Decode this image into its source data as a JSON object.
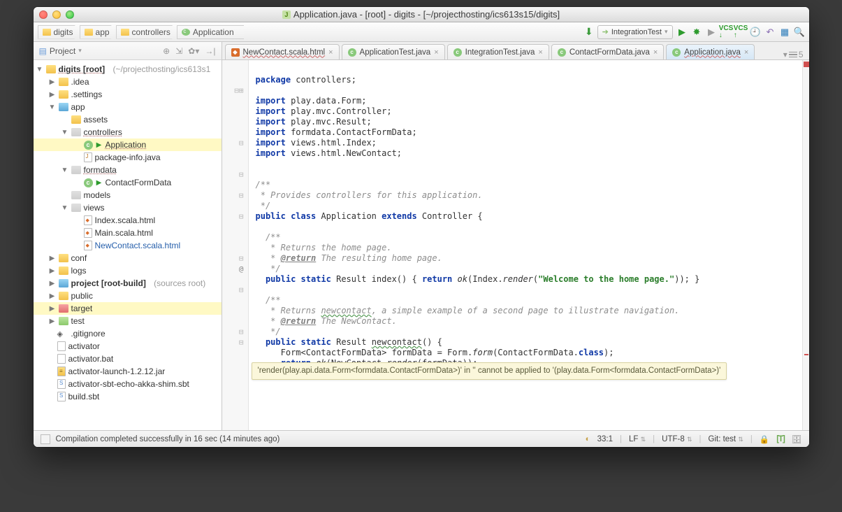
{
  "window": {
    "title": "Application.java - [root] - digits - [~/projecthosting/ics613s15/digits]"
  },
  "breadcrumbs": [
    "digits",
    "app",
    "controllers",
    "Application"
  ],
  "runconfig": "IntegrationTest",
  "sidebar": {
    "title": "Project",
    "root": "digits [root]",
    "root_hint": "(~/projecthosting/ics613s1",
    "nodes": {
      "idea": ".idea",
      "settings": ".settings",
      "app": "app",
      "assets": "assets",
      "controllers": "controllers",
      "application": "Application",
      "package_info": "package-info.java",
      "formdata": "formdata",
      "contactformdata": "ContactFormData",
      "models": "models",
      "views": "views",
      "index_html": "Index.scala.html",
      "main_html": "Main.scala.html",
      "newcontact_html": "NewContact.scala.html",
      "conf": "conf",
      "logs": "logs",
      "project": "project [root-build]",
      "project_hint": "(sources root)",
      "public": "public",
      "target": "target",
      "test": "test",
      "gitignore": ".gitignore",
      "activator": "activator",
      "activator_bat": "activator.bat",
      "activator_jar": "activator-launch-1.2.12.jar",
      "activator_sbt": "activator-sbt-echo-akka-shim.sbt",
      "build_sbt": "build.sbt"
    }
  },
  "tabs": [
    {
      "label": "NewContact.scala.html",
      "icon": "h",
      "wavy": true,
      "blue": false
    },
    {
      "label": "ApplicationTest.java",
      "icon": "c",
      "wavy": false,
      "blue": false
    },
    {
      "label": "IntegrationTest.java",
      "icon": "c",
      "wavy": false,
      "blue": false
    },
    {
      "label": "ContactFormData.java",
      "icon": "c",
      "wavy": false,
      "blue": false
    },
    {
      "label": "Application.java",
      "icon": "c",
      "wavy": true,
      "blue": true,
      "active": true
    }
  ],
  "code": {
    "l1_kw": "package",
    "l1_rest": " controllers;",
    "l2_kw": "import",
    "l2_rest": " play.data.Form;",
    "l3_kw": "import",
    "l3_rest": " play.mvc.Controller;",
    "l4_kw": "import",
    "l4_rest": " play.mvc.Result;",
    "l5_kw": "import",
    "l5_rest": " formdata.ContactFormData;",
    "l6_kw": "import",
    "l6_rest": " views.html.Index;",
    "l7_kw": "import",
    "l7_rest": " views.html.NewContact;",
    "doc1_a": "/**",
    "doc1_b": " * Provides controllers for this application.",
    "doc1_c": " */",
    "cls_a": "public class ",
    "cls_name": "Application ",
    "cls_b": "extends ",
    "cls_sup": "Controller {",
    "doc2_a": "/**",
    "doc2_b": " * Returns the home page.",
    "doc2_ret": "@return",
    "doc2_c": " The resulting home page.",
    "doc2_d": " */",
    "m1_a": "public static ",
    "m1_b": "Result index() ",
    "m1_c": "{ ",
    "m1_d": "return ",
    "m1_e": "ok",
    "m1_f": "(Index.",
    "m1_g": "render",
    "m1_h": "(",
    "m1_str": "\"Welcome to the home page.\"",
    "m1_i": ")); ",
    "m1_j": "}",
    "doc3_a": "/**",
    "doc3_b1": " * Returns ",
    "doc3_nc": "newcontact",
    "doc3_b2": ", a simple example of a second page to illustrate navigation.",
    "doc3_ret": "@return",
    "doc3_c": " The NewContact.",
    "doc3_d": " */",
    "m2_a": "public static ",
    "m2_b": "Result ",
    "m2_nc": "newcontact",
    "m2_c": "() {",
    "m2_l2a": "   Form<ContactFormData> formData = Form.",
    "m2_l2b": "form",
    "m2_l2c": "(ContactFormData.",
    "m2_l2d": "class",
    "m2_l2e": ");",
    "m2_l3a": "   ",
    "m2_l3b": "return ",
    "m2_l3c": "ok",
    "m2_l3d": "(NewContact.",
    "m2_l3e": "render",
    "m2_l3f": "(",
    "m2_l3g": "formData",
    "m2_l3h": "));",
    "m2_end": "}"
  },
  "tooltip": "'render(play.api.data.Form<formdata.ContactFormData>)' in '' cannot be applied to '(play.data.Form<formdata.ContactFormData>)'",
  "status": {
    "msg": "Compilation completed successfully in 16 sec (14 minutes ago)",
    "pos": "33:1",
    "sep": "LF",
    "enc": "UTF-8",
    "git": "Git: test"
  }
}
